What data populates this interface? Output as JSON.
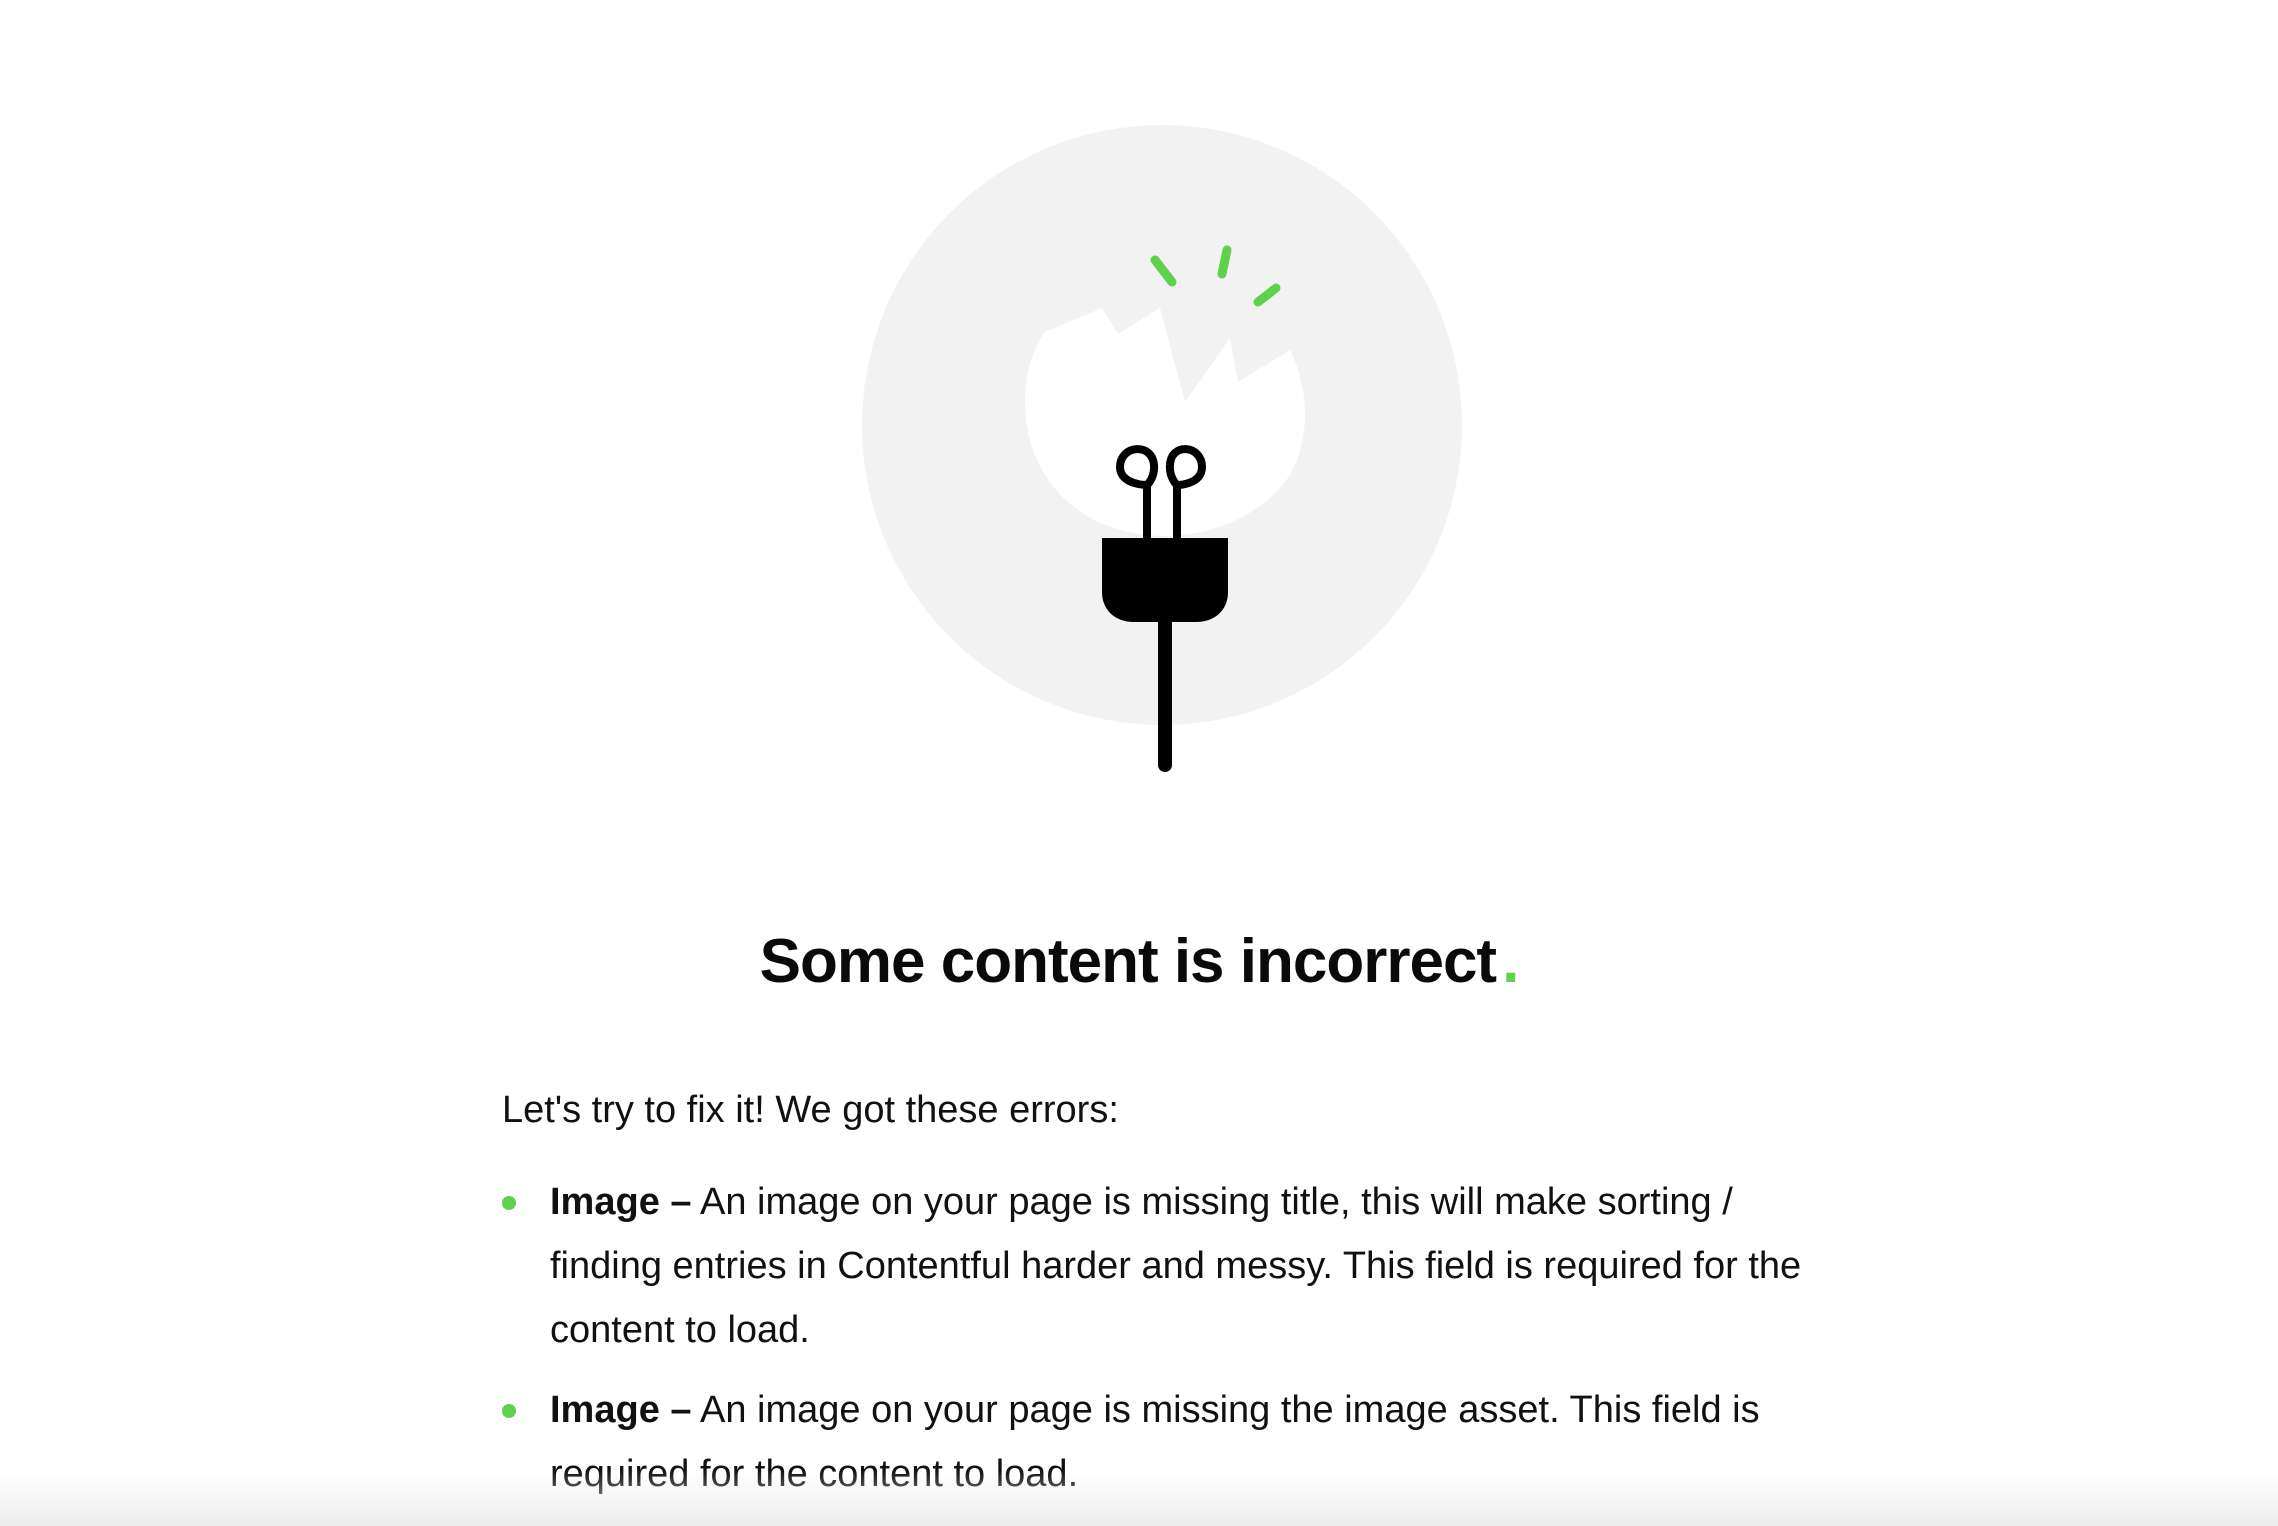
{
  "illustration": {
    "icon": "unplugged-plug-icon",
    "accent_color": "#5fd14a",
    "circle_color": "#f2f2f2"
  },
  "heading": {
    "text": "Some content is incorrect",
    "dot": "."
  },
  "intro": "Let's try to fix it! We got these errors:",
  "errors": [
    {
      "label": "Image –",
      "message": " An image on your page is missing title, this will make sorting / finding entries in Contentful harder and messy. This field is required for the content to load."
    },
    {
      "label": "Image –",
      "message": " An image on your page is missing the image asset. This field is required for the content to load."
    }
  ]
}
